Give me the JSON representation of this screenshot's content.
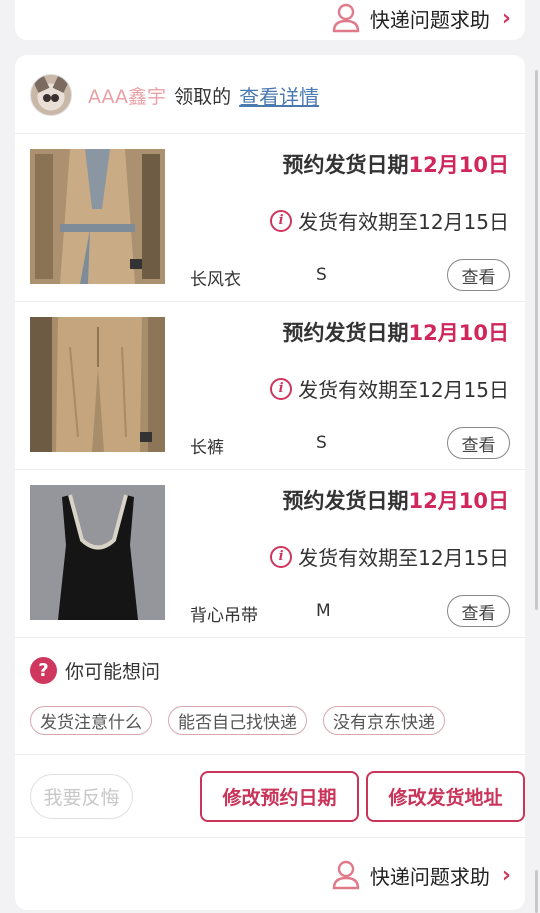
{
  "help": {
    "label": "快递问题求助",
    "icon": "person-icon",
    "chevron": "›"
  },
  "claimer": {
    "name": "AAA鑫宇",
    "verb": "领取的",
    "detail_link": "查看详情"
  },
  "items": [
    {
      "ship_prefix": "预约发货日期",
      "ship_date": "12月10日",
      "valid_text": "发货有效期至12月15日",
      "name": "长风衣",
      "size": "S",
      "view_label": "查看"
    },
    {
      "ship_prefix": "预约发货日期",
      "ship_date": "12月10日",
      "valid_text": "发货有效期至12月15日",
      "name": "长裤",
      "size": "S",
      "view_label": "查看"
    },
    {
      "ship_prefix": "预约发货日期",
      "ship_date": "12月10日",
      "valid_text": "发货有效期至12月15日",
      "name": "背心吊带",
      "size": "M",
      "view_label": "查看"
    }
  ],
  "faq": {
    "title": "你可能想问",
    "icon": "?",
    "chips": [
      "发货注意什么",
      "能否自己找快递",
      "没有京东快递"
    ]
  },
  "actions": {
    "regret": "我要反悔",
    "change_date": "修改预约日期",
    "change_address": "修改发货地址"
  },
  "colors": {
    "accent": "#d0275a",
    "link": "#4a7ab0",
    "name": "#e9a0a6"
  }
}
